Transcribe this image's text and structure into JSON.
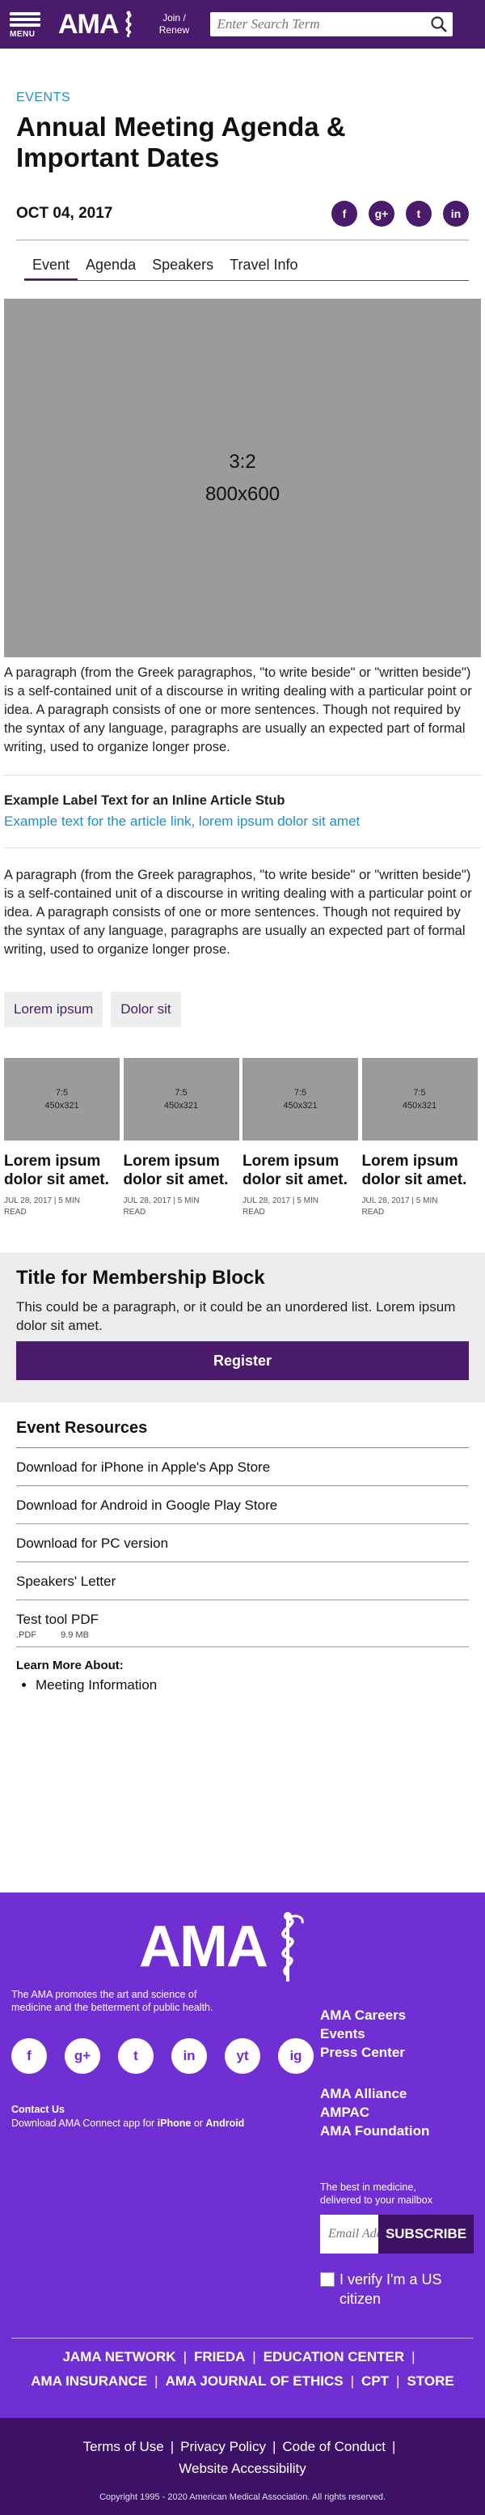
{
  "header": {
    "menu_label": "MENU",
    "logo_text": "AMA",
    "join_line1": "Join /",
    "join_line2": "Renew",
    "search_placeholder": "Enter Search Term"
  },
  "article": {
    "eyebrow": "EVENTS",
    "title_line1": "Annual Meeting Agenda &",
    "title_line2": "Important Dates",
    "date": "OCT 04, 2017",
    "share": [
      "f",
      "g+",
      "t",
      "in"
    ]
  },
  "tabs": [
    {
      "label": "Event",
      "active": true
    },
    {
      "label": "Agenda",
      "active": false
    },
    {
      "label": "Speakers",
      "active": false
    },
    {
      "label": "Travel Info",
      "active": false
    }
  ],
  "hero": {
    "ratio": "3:2",
    "size": "800x600"
  },
  "paragraph1": "A paragraph (from the Greek paragraphos, \"to write beside\" or \"written beside\") is a self-contained unit of a discourse in writing dealing with a particular point or idea. A paragraph consists of one or more sentences. Though not required by the syntax of any language, paragraphs are usually an expected part of formal writing, used to organize longer prose.",
  "inline_stub": {
    "label": "Example Label Text for an Inline Article Stub",
    "link": "Example text for the article link, lorem ipsum dolor sit amet"
  },
  "paragraph2": "A paragraph (from the Greek paragraphos, \"to write beside\" or \"written beside\") is a self-contained unit of a discourse in writing dealing with a particular point or idea. A paragraph consists of one or more sentences. Though not required by the syntax of any language, paragraphs are usually an expected part of formal writing, used to organize longer prose.",
  "tags": [
    "Lorem ipsum",
    "Dolor sit"
  ],
  "cards": [
    {
      "ratio": "7:5",
      "size": "450x321",
      "title": "Lorem ipsum dolor sit amet.",
      "meta1": "JUL 28, 2017 | 5 MIN",
      "meta2": "READ"
    },
    {
      "ratio": "7:5",
      "size": "450x321",
      "title": "Lorem ipsum dolor sit amet.",
      "meta1": "JUL 28, 2017 | 5 MIN",
      "meta2": "READ"
    },
    {
      "ratio": "7:5",
      "size": "450x321",
      "title": "Lorem ipsum dolor sit amet.",
      "meta1": "JUL 28, 2017 | 5 MIN",
      "meta2": "READ"
    },
    {
      "ratio": "7:5",
      "size": "450x321",
      "title": "Lorem ipsum dolor sit amet.",
      "meta1": "JUL 28, 2017 | 5 MIN",
      "meta2": "READ"
    }
  ],
  "membership": {
    "title": "Title for Membership Block",
    "text": "This could be a paragraph, or it could be an unordered list. Lorem ipsum dolor sit amet.",
    "button": "Register"
  },
  "resources": {
    "title": "Event Resources",
    "items": [
      "Download for iPhone in Apple's App Store",
      "Download for Android in Google Play Store",
      "Download for PC version",
      "Speakers' Letter"
    ],
    "file": {
      "name": "Test tool PDF",
      "type": ".PDF",
      "size": "9.9 MB"
    },
    "learn_title": "Learn More About:",
    "learn_items": [
      "Meeting Information"
    ]
  },
  "footer": {
    "logo_text": "AMA",
    "mission": "The AMA promotes the art and science of medicine and the betterment of public health.",
    "socials": [
      "f",
      "g+",
      "t",
      "in",
      "yt",
      "ig"
    ],
    "contact_title": "Contact Us",
    "contact_text_pre": "Download AMA Connect app for ",
    "contact_iphone": "iPhone",
    "contact_or": " or ",
    "contact_android": "Android",
    "links": [
      "AMA Careers",
      "Events",
      "Press Center"
    ],
    "links2": [
      "AMA Alliance",
      "AMPAC",
      "AMA Foundation"
    ],
    "best_line1": "The best in medicine,",
    "best_line2": "delivered to your mailbox",
    "email_placeholder": "Email Address",
    "subscribe": "SUBSCRIBE",
    "verify_line1": "I verify I'm a US",
    "verify_line2": "citizen",
    "brands_row1": [
      "JAMA NETWORK",
      "FRIEDA",
      "EDUCATION CENTER"
    ],
    "brands_row2": [
      "AMA INSURANCE",
      "AMA JOURNAL OF ETHICS",
      "CPT",
      "STORE"
    ],
    "legal_row1": [
      "Terms of Use",
      "Privacy Policy",
      "Code of Conduct"
    ],
    "legal_row2": "Website Accessibility",
    "copyright": "Copyright 1995 - 2020 American Medical Association. All rights reserved."
  },
  "colors": {
    "brand_purple": "#4a1b6b",
    "footer_purple": "#6f2fd2",
    "link_blue": "#1e8fc8",
    "placeholder_gray": "#9b9b9b"
  }
}
